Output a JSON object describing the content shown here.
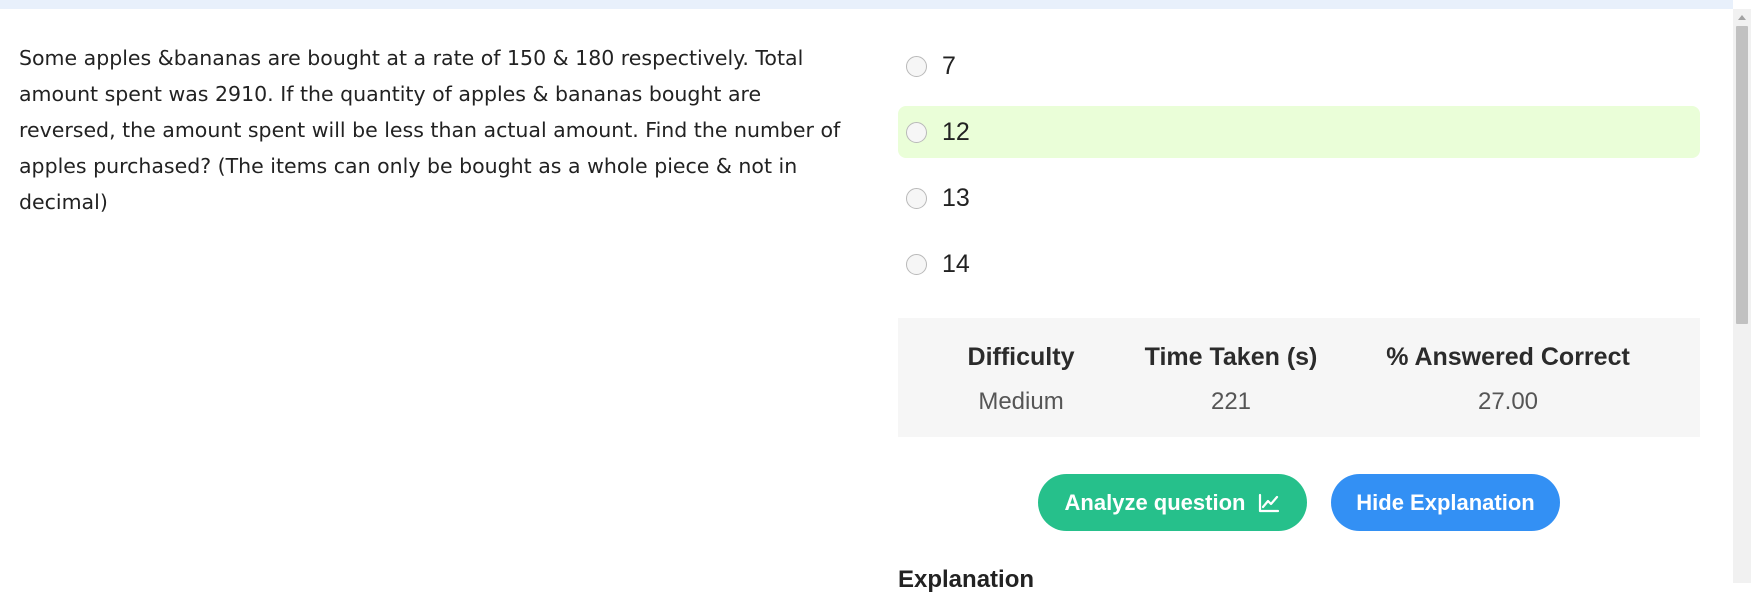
{
  "question": {
    "text": "Some apples &bananas are bought at a rate of 150 & 180 respectively. Total amount spent was 2910. If the quantity of apples & bananas bought are reversed, the amount spent will be less than actual amount. Find the number of apples purchased? (The items can only be bought as a whole piece & not in decimal)"
  },
  "options": [
    {
      "label": "7",
      "selected": false
    },
    {
      "label": "12",
      "selected": true
    },
    {
      "label": "13",
      "selected": false
    },
    {
      "label": "14",
      "selected": false
    }
  ],
  "stats": {
    "difficulty_label": "Difficulty",
    "difficulty_value": "Medium",
    "time_label": "Time Taken (s)",
    "time_value": "221",
    "correct_label": "% Answered Correct",
    "correct_value": "27.00"
  },
  "actions": {
    "analyze_label": "Analyze question",
    "analyze_icon": "line-chart-icon",
    "hide_label": "Hide Explanation"
  },
  "explanation": {
    "heading": "Explanation"
  },
  "colors": {
    "selected_option_bg": "#eafed8",
    "analyze_button": "#26c08b",
    "hide_button": "#3390f4",
    "stats_bg": "#f6f6f6"
  }
}
